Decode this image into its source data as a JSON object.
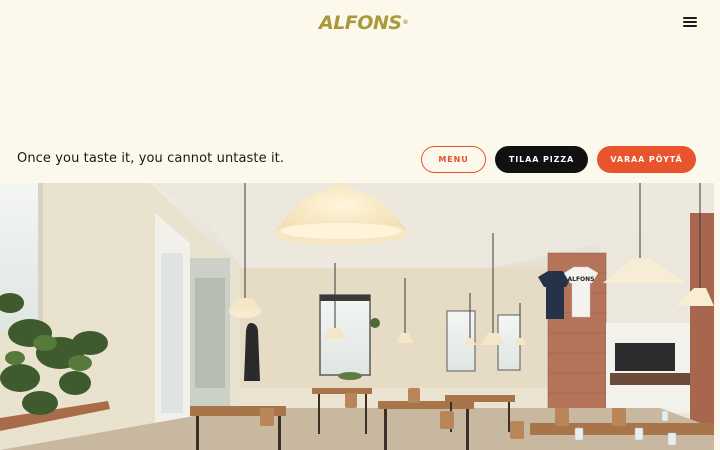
{
  "header": {
    "logo_text": "ALFONS",
    "logo_mark": "®",
    "menu_icon": "hamburger-menu-icon"
  },
  "hero": {
    "tagline": "Once you taste it, you cannot untaste it.",
    "buttons": {
      "menu_label": "MENU",
      "order_label": "TILAA PIZZA",
      "book_label": "VARAA PÖYTÄ"
    },
    "image_alt": "Interior of the Alfons restaurant",
    "tshirt_text": "ALFONS"
  },
  "colors": {
    "background": "#fdf8ec",
    "accent": "#e8542c",
    "logo": "#a89a3c",
    "dark": "#111111"
  }
}
